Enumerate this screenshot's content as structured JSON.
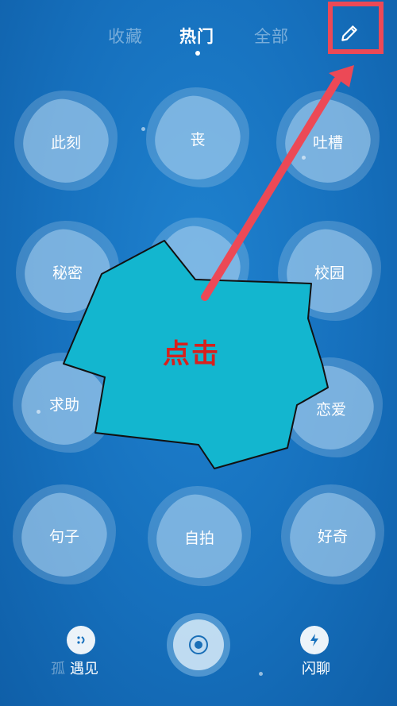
{
  "tabs": {
    "favorites": "收藏",
    "hot": "热门",
    "all": "全部"
  },
  "topics": [
    {
      "label": "此刻"
    },
    {
      "label": "丧"
    },
    {
      "label": "吐槽"
    },
    {
      "label": "秘密"
    },
    {
      "label": "校园"
    },
    {
      "label": "求助"
    },
    {
      "label": "恋爱"
    },
    {
      "label": "句子"
    },
    {
      "label": "自拍"
    },
    {
      "label": "好奇"
    }
  ],
  "bottom_nav": {
    "left_faded": "孤",
    "left_label": "遇见",
    "right_label": "闪聊"
  },
  "annotation": {
    "burst_text": "点击",
    "arrow_color": "#ec4956",
    "burst_fill": "#13b6cf"
  },
  "icons": {
    "edit": "pencil-icon",
    "meet": "smile-chat-icon",
    "center": "target-icon",
    "flash_chat": "lightning-chat-icon"
  }
}
